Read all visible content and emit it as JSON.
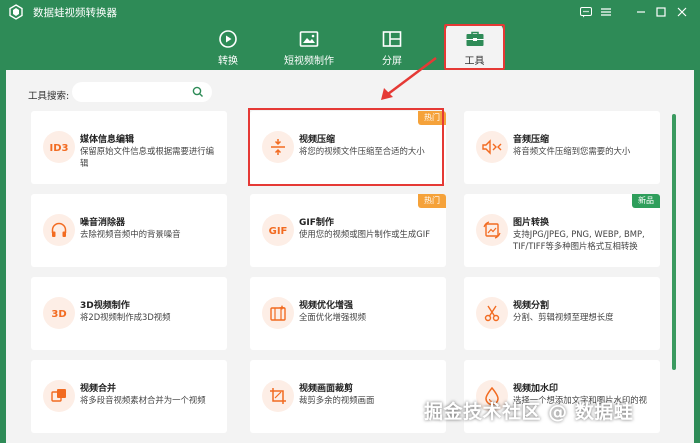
{
  "app": {
    "title": "数据蛙视频转换器"
  },
  "window_controls": [
    "feedback-icon",
    "menu-icon",
    "minimize-icon",
    "maximize-icon",
    "close-icon"
  ],
  "tabs": [
    {
      "label": "转换",
      "icon": "convert-icon"
    },
    {
      "label": "短视频制作",
      "icon": "short-video-icon"
    },
    {
      "label": "分屏",
      "icon": "split-screen-icon"
    },
    {
      "label": "工具",
      "icon": "toolbox-icon",
      "active": true
    }
  ],
  "search": {
    "label": "工具搜索:",
    "placeholder": ""
  },
  "tools": [
    {
      "title": "媒体信息编辑",
      "desc": "保留原始文件信息或根据需要进行编辑",
      "icon": "id3-icon",
      "icon_text": "ID3"
    },
    {
      "title": "视频压缩",
      "desc": "将您的视频文件压缩至合适的大小",
      "icon": "compress-icon",
      "badge": "热门"
    },
    {
      "title": "音频压缩",
      "desc": "将音频文件压缩到您需要的大小",
      "icon": "audio-compress-icon"
    },
    {
      "title": "噪音消除器",
      "desc": "去除视频音频中的背景噪音",
      "icon": "headphones-icon"
    },
    {
      "title": "GIF制作",
      "desc": "使用您的视频或图片制作或生成GIF",
      "icon": "gif-icon",
      "icon_text": "GIF",
      "badge": "热门"
    },
    {
      "title": "图片转换",
      "desc": "支持JPG/JPEG, PNG, WEBP, BMP, TIF/TIFF等多种图片格式互相转换",
      "icon": "image-convert-icon",
      "badge": "新品"
    },
    {
      "title": "3D视频制作",
      "desc": "将2D视频制作成3D视频",
      "icon": "3d-icon",
      "icon_text": "3D"
    },
    {
      "title": "视频优化增强",
      "desc": "全面优化增强视频",
      "icon": "enhance-icon"
    },
    {
      "title": "视频分割",
      "desc": "分割、剪辑视频至理想长度",
      "icon": "scissors-icon"
    },
    {
      "title": "视频合并",
      "desc": "将多段音视频素材合并为一个视频",
      "icon": "merge-icon"
    },
    {
      "title": "视频画面裁剪",
      "desc": "裁剪多余的视频画面",
      "icon": "crop-icon"
    },
    {
      "title": "视频加水印",
      "desc": "选择一个想添加文字和图片水印的视",
      "icon": "watermark-icon"
    }
  ],
  "watermark": "掘金技术社区 @ 数据蛙",
  "colors": {
    "brand_green": "#2e8b57",
    "accent_orange": "#f26b21",
    "hot_badge": "#f5a23a",
    "new_badge": "#2e9e5b",
    "highlight_red": "#e53935"
  }
}
